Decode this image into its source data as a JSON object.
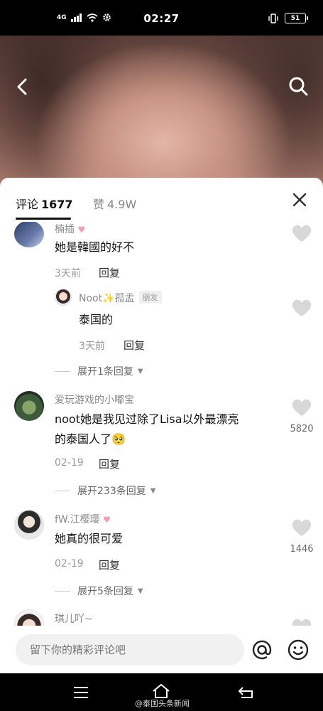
{
  "status_bar": {
    "time": "02:27",
    "network": "4G",
    "battery": "51"
  },
  "sheet": {
    "tab_comments_label": "评论",
    "tab_comments_count": "1677",
    "tab_likes_label": "赞",
    "tab_likes_count": "4.9W"
  },
  "comments": [
    {
      "username": "楠插",
      "text": "她是韓國的好不",
      "time": "3天前",
      "reply_label": "回复"
    },
    {
      "username": "Noot✨孤盂",
      "badge": "朋友",
      "text": "泰国的",
      "time": "3天前",
      "reply_label": "回复",
      "expand_label": "展开1条回复"
    },
    {
      "username": "爱玩游戏的小嘟宝",
      "text_line1": "noot她是我见过除了Lisa以外最漂亮",
      "text_line2": "的泰国人了🥺",
      "time": "02-19",
      "reply_label": "回复",
      "likes": "5820",
      "expand_label": "展开233条回复"
    },
    {
      "username": "fW.江樱璎",
      "text": "她真的很可爱",
      "time": "02-19",
      "reply_label": "回复",
      "likes": "1446",
      "expand_label": "展开5条回复"
    },
    {
      "username": "琪儿吖~"
    }
  ],
  "input": {
    "placeholder": "留下你的精彩评论吧"
  },
  "watermark": "@泰国头条新闻",
  "colors": {
    "like_icon": "#d8d8d8",
    "username": "#8a8a8a",
    "sheet_bg": "#ffffff",
    "input_bg": "#f1f1f1"
  }
}
